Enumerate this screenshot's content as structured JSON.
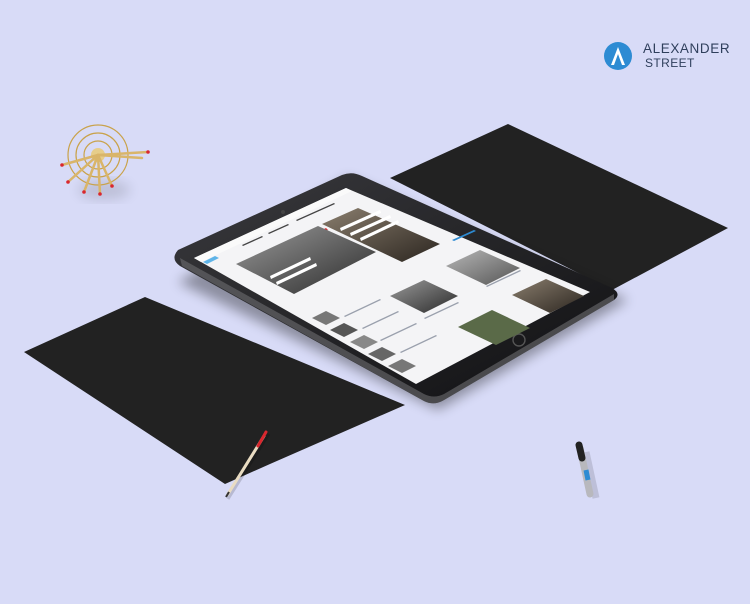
{
  "brand": {
    "line1": "ALEXANDER",
    "line2": "STREET"
  },
  "colors": {
    "background": "#d8dbf7",
    "brand_blue": "#2d8bd3",
    "brand_text": "#2f3f5c",
    "paper": "#222222",
    "tablet_frame": "#1c1c1e",
    "screen": "#f4f4f6",
    "accent_red": "#d9272e"
  },
  "icons": [
    "brand-logo-icon",
    "pencil-cup-icon",
    "pencil-icon",
    "marker-icon",
    "home-button-icon"
  ]
}
